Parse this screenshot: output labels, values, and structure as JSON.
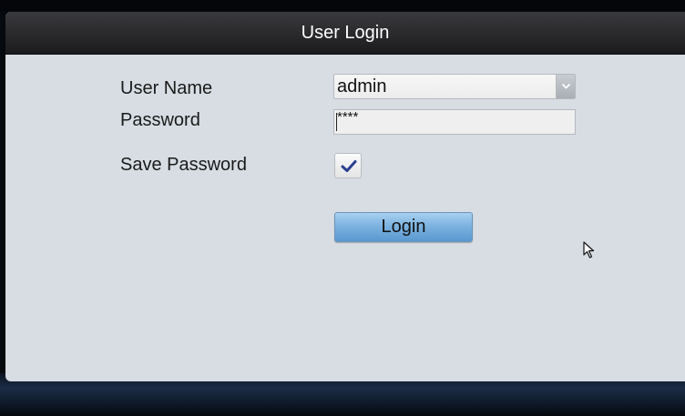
{
  "dialog": {
    "title": "User Login"
  },
  "form": {
    "username_label": "User Name",
    "username_value": "admin",
    "password_label": "Password",
    "password_value": "****",
    "save_password_label": "Save Password",
    "save_password_checked": true,
    "login_button_label": "Login"
  },
  "icons": {
    "dropdown": "chevron-down-icon",
    "checkbox": "checkmark-icon",
    "cursor": "mouse-pointer-icon"
  },
  "colors": {
    "title_bar": "#1b1b1d",
    "dialog_bg": "#d7dde3",
    "login_button": "#7cb3e0",
    "checkmark": "#2b3f8f"
  }
}
